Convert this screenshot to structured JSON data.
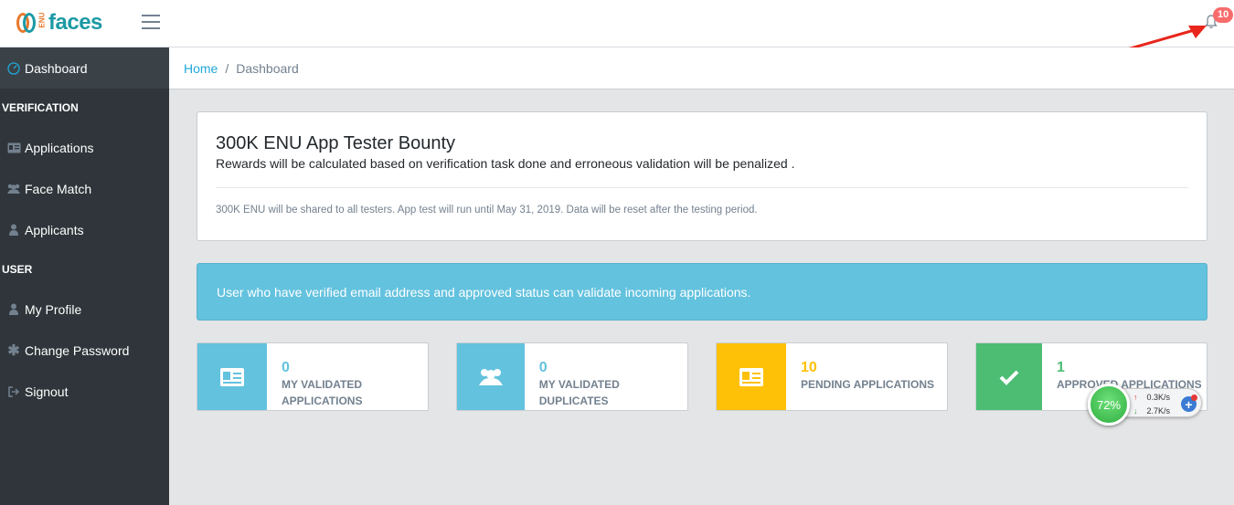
{
  "header": {
    "logo_small": "ENU",
    "logo_text": "faces",
    "notification_count": "10"
  },
  "sidebar": {
    "items": [
      {
        "label": "Dashboard",
        "icon": "speedometer-icon",
        "active": true
      },
      {
        "section": "VERIFICATION"
      },
      {
        "label": "Applications",
        "icon": "id-card-icon"
      },
      {
        "label": "Face Match",
        "icon": "users-icon"
      },
      {
        "label": "Applicants",
        "icon": "user-icon"
      },
      {
        "section": "USER"
      },
      {
        "label": "My Profile",
        "icon": "user-icon"
      },
      {
        "label": "Change Password",
        "icon": "asterisk-icon"
      },
      {
        "label": "Signout",
        "icon": "sign-out-icon"
      }
    ]
  },
  "breadcrumb": {
    "home": "Home",
    "separator": "/",
    "current": "Dashboard"
  },
  "info_card": {
    "title": "300K ENU App Tester Bounty",
    "subtitle": "Rewards will be calculated based on verification task done and erroneous validation will be penalized .",
    "note": "300K ENU will be shared to all testers. App test will run until May 31, 2019. Data will be reset after the testing period."
  },
  "alert": {
    "text": "User who have verified email address and approved status can validate incoming applications."
  },
  "widgets": [
    {
      "value": "0",
      "label": "MY VALIDATED APPLICATIONS",
      "icon": "id-card-icon",
      "color": "#63c2de"
    },
    {
      "value": "0",
      "label": "MY VALIDATED DUPLICATES",
      "icon": "users-icon",
      "color": "#63c2de"
    },
    {
      "value": "10",
      "label": "PENDING APPLICATIONS",
      "icon": "id-card-icon",
      "color": "#ffc107"
    },
    {
      "value": "1",
      "label": "APPROVED APPLICATIONS",
      "icon": "check-icon",
      "color": "#4dbd74"
    }
  ],
  "speed_monitor": {
    "percent": "72%",
    "upload": "0.3K/s",
    "download": "2.7K/s"
  },
  "colors": {
    "sidebar_bg": "#2f353a",
    "accent": "#20a8d8",
    "info": "#63c2de",
    "warning": "#ffc107",
    "success": "#4dbd74",
    "badge": "#f86c6b"
  }
}
